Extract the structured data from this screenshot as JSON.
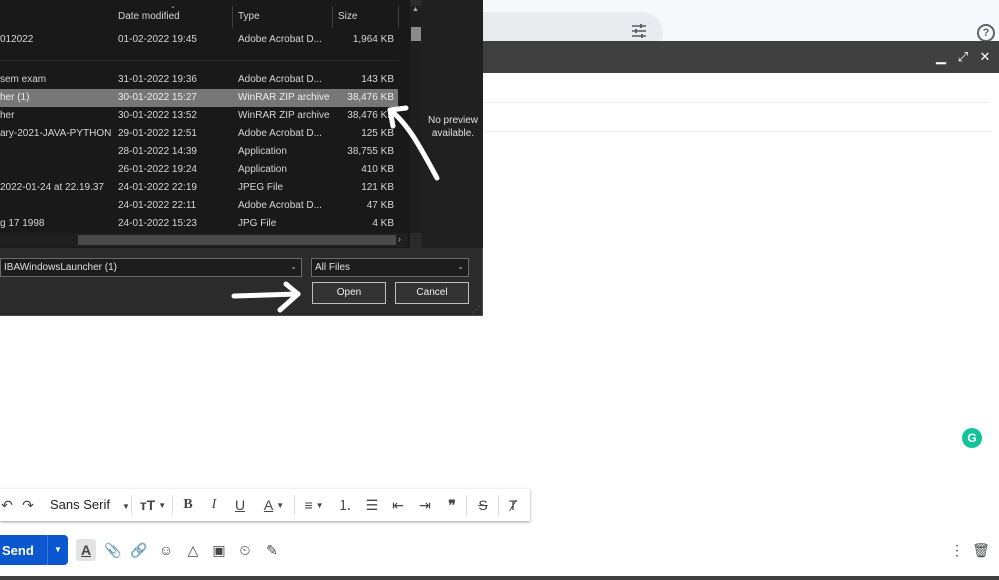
{
  "dialog": {
    "columns": {
      "date": "Date modified",
      "type": "Type",
      "size": "Size"
    },
    "files": [
      {
        "name": "012022",
        "date": "01-02-2022 19:45",
        "type": "Adobe Acrobat D...",
        "size": "1,964 KB"
      },
      {
        "name": "sem exam",
        "date": "31-01-2022 19:36",
        "type": "Adobe Acrobat D...",
        "size": "143 KB"
      },
      {
        "name": "her (1)",
        "date": "30-01-2022 15:27",
        "type": "WinRAR ZIP archive",
        "size": "38,476 KB",
        "selected": true
      },
      {
        "name": "her",
        "date": "30-01-2022 13:52",
        "type": "WinRAR ZIP archive",
        "size": "38,476 KB"
      },
      {
        "name": "ary-2021-JAVA-PYTHON",
        "date": "29-01-2022 12:51",
        "type": "Adobe Acrobat D...",
        "size": "125 KB"
      },
      {
        "name": "",
        "date": "28-01-2022 14:39",
        "type": "Application",
        "size": "38,755 KB"
      },
      {
        "name": "",
        "date": "26-01-2022 19:24",
        "type": "Application",
        "size": "410 KB"
      },
      {
        "name": "2022-01-24 at 22.19.37",
        "date": "24-01-2022 22:19",
        "type": "JPEG File",
        "size": "121 KB"
      },
      {
        "name": "",
        "date": "24-01-2022 22:11",
        "type": "Adobe Acrobat D...",
        "size": "47 KB"
      },
      {
        "name": "g 17 1998",
        "date": "24-01-2022 15:23",
        "type": "JPG File",
        "size": "4 KB"
      }
    ],
    "preview_text": "No preview available.",
    "filename_value": "IBAWindowsLauncher (1)",
    "filetype_value": "All Files",
    "open_label": "Open",
    "cancel_label": "Cancel"
  },
  "compose": {
    "font_name": "Sans Serif",
    "send_label": "Send",
    "help_glyph": "?",
    "grammarly_glyph": "G"
  },
  "icons": [
    "undo-icon",
    "redo-icon",
    "text-size-icon",
    "bold-icon",
    "italic-icon",
    "underline-icon",
    "text-color-icon",
    "align-icon",
    "numbered-list-icon",
    "bulleted-list-icon",
    "indent-less-icon",
    "indent-more-icon",
    "quote-icon",
    "strikethrough-icon",
    "remove-formatting-icon",
    "formatting-options-icon",
    "attach-icon",
    "link-icon",
    "emoji-icon",
    "drive-icon",
    "photo-icon",
    "confidential-icon",
    "signature-icon",
    "more-options-icon",
    "trash-icon"
  ],
  "colors": {
    "accent": "#0b57d0",
    "dialog_bg": "#2b2b2b",
    "selected_row": "#777777",
    "compose_header": "#404040",
    "grammarly": "#15c39a"
  }
}
